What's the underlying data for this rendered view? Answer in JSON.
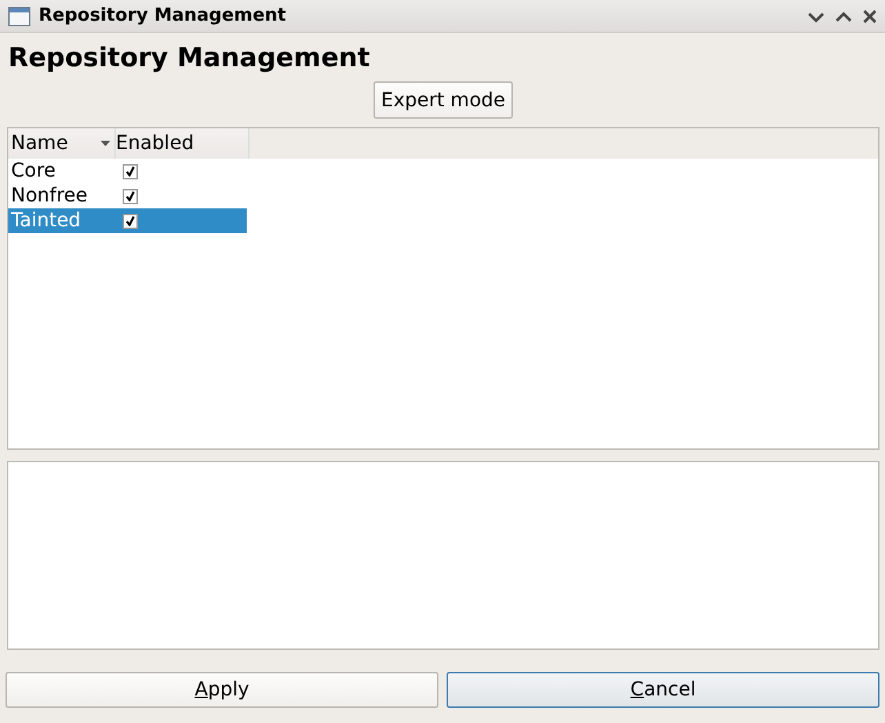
{
  "window": {
    "title": "Repository Management"
  },
  "heading": "Repository Management",
  "expert_button": {
    "label": "Expert mode"
  },
  "table": {
    "columns": [
      {
        "label": "Name",
        "sort": true
      },
      {
        "label": "Enabled",
        "sort": false
      }
    ],
    "rows": [
      {
        "name": "Core",
        "enabled": true,
        "selected": false
      },
      {
        "name": "Nonfree",
        "enabled": true,
        "selected": false
      },
      {
        "name": "Tainted",
        "enabled": true,
        "selected": true
      }
    ]
  },
  "buttons": [
    {
      "label": "Apply",
      "mnemonic": true,
      "default": false
    },
    {
      "label": "Cancel",
      "mnemonic": true,
      "default": true
    }
  ]
}
